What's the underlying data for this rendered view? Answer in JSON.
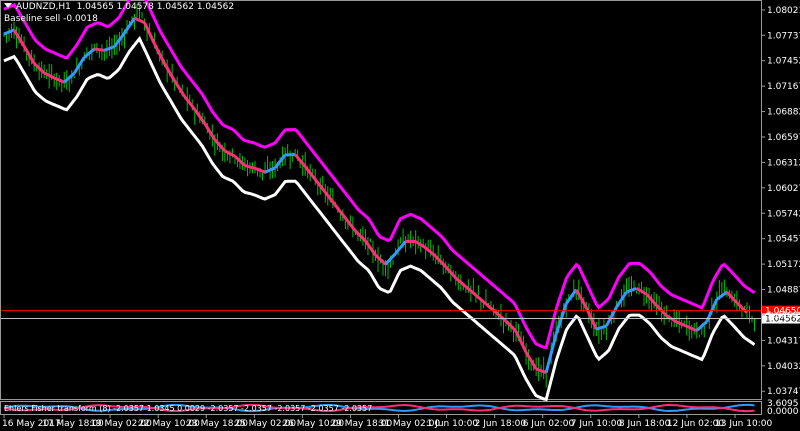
{
  "header": {
    "title": "AUDNZD,H1",
    "ohlc": "1.04565 1.04578 1.04562 1.04562",
    "subline": "Baseline sell -0.0018"
  },
  "indicator": {
    "label": "Ehlers Fisher transform (8) -2.0357 1.0345 0.0029 -2.0357 -2.0357 -2.0357 -2.0357 -2.0357",
    "axis_top": "3.6095",
    "axis_bottom": "0.0000"
  },
  "colors": {
    "background": "#000000",
    "candles": "#00c000",
    "upper_band": "#ff00ff",
    "lower_band": "#ffffff",
    "baseline_up": "#3399ff",
    "baseline_down": "#ff2d7a",
    "price_line": "#ff0000",
    "current_line": "#c0c0c0"
  },
  "chart_data": {
    "type": "line",
    "title": "AUDNZD,H1",
    "y_ticks": [
      "1.08021",
      "1.07737",
      "1.07452",
      "1.07167",
      "1.06882",
      "1.06597",
      "1.06312",
      "1.06027",
      "1.05742",
      "1.05457",
      "1.05172",
      "1.04887",
      "1.04602",
      "1.04317",
      "1.04032",
      "1.03747"
    ],
    "ylim": [
      1.0366,
      1.0811
    ],
    "x_ticks": [
      "16 May 2017",
      "17 May 18:00",
      "19 May 02:00",
      "22 May 10:00",
      "23 May 18:00",
      "25 May 02:00",
      "26 May 10:00",
      "29 May 18:00",
      "31 May 02:00",
      "1 Jun 10:00",
      "2 Jun 18:00",
      "6 Jun 02:00",
      "7 Jun 10:00",
      "8 Jun 18:00",
      "12 Jun 02:00",
      "13 Jun 10:00"
    ],
    "price_labels": {
      "current": "1.04562",
      "bid_line": "1.04650"
    },
    "current_price": 1.04562,
    "red_line_price": 1.0465,
    "series": [
      {
        "name": "price",
        "values": [
          1.0775,
          1.078,
          1.076,
          1.074,
          1.073,
          1.0725,
          1.072,
          1.0735,
          1.0755,
          1.076,
          1.0755,
          1.0765,
          1.0785,
          1.08,
          1.0775,
          1.075,
          1.073,
          1.071,
          1.0695,
          1.068,
          1.066,
          1.0645,
          1.064,
          1.0628,
          1.0625,
          1.062,
          1.0625,
          1.064,
          1.064,
          1.0625,
          1.061,
          1.0595,
          1.058,
          1.0565,
          1.055,
          1.054,
          1.052,
          1.0515,
          1.054,
          1.0545,
          1.054,
          1.053,
          1.052,
          1.0505,
          1.0495,
          1.0485,
          1.0475,
          1.0465,
          1.0455,
          1.0445,
          1.042,
          1.04,
          1.0395,
          1.044,
          1.0475,
          1.049,
          1.0465,
          1.044,
          1.045,
          1.0475,
          1.049,
          1.049,
          1.048,
          1.0465,
          1.0455,
          1.045,
          1.0445,
          1.044,
          1.047,
          1.049,
          1.0478,
          1.0465,
          1.0457
        ]
      }
    ]
  }
}
